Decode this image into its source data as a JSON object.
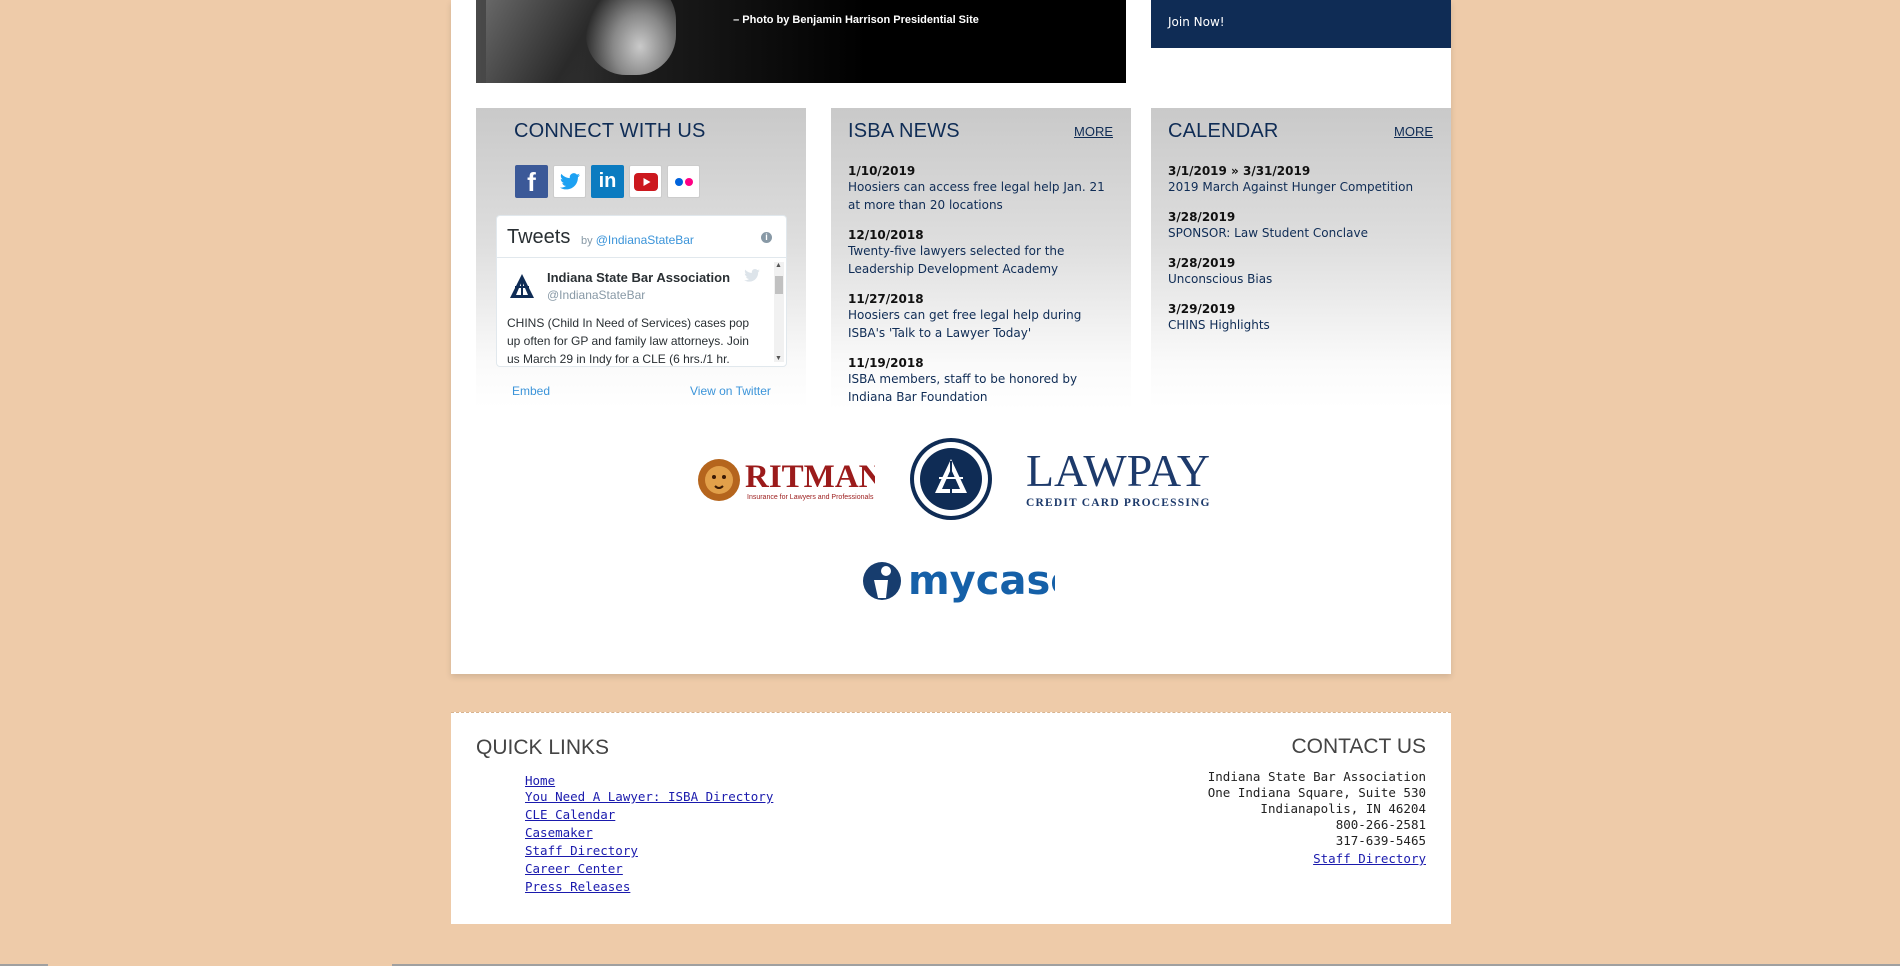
{
  "hero": {
    "photo_credit": "– Photo by Benjamin Harrison Presidential Site"
  },
  "join": {
    "label": "Join Now!"
  },
  "connect": {
    "title": "CONNECT WITH US",
    "social_icons": [
      "facebook-icon",
      "twitter-icon",
      "linkedin-icon",
      "youtube-icon",
      "flickr-icon"
    ],
    "timeline": {
      "heading": "Tweets",
      "by": "by",
      "handle_link": "@IndianaStateBar",
      "tweet": {
        "author": "Indiana State Bar Association",
        "handle": "@IndianaStateBar",
        "text": "CHINS (Child In Need of Services) cases pop up often for GP and family law attorneys. Join us March 29 in Indy for a CLE (6 hrs./1 hr."
      },
      "embed_label": "Embed",
      "view_label": "View on Twitter"
    }
  },
  "news": {
    "title": "ISBA NEWS",
    "more": "MORE",
    "items": [
      {
        "date": "1/10/2019",
        "title": "Hoosiers can access free legal help Jan. 21 at more than 20 locations"
      },
      {
        "date": "12/10/2018",
        "title": "Twenty-five lawyers selected for the Leadership Development Academy"
      },
      {
        "date": "11/27/2018",
        "title": "Hoosiers can get free legal help during ISBA's 'Talk to a Lawyer Today'"
      },
      {
        "date": "11/19/2018",
        "title": "ISBA members, staff to be honored by Indiana Bar Foundation"
      }
    ]
  },
  "calendar": {
    "title": "CALENDAR",
    "more": "MORE",
    "items": [
      {
        "date": "3/1/2019 » 3/31/2019",
        "title": "2019 March Against Hunger Competition"
      },
      {
        "date": "3/28/2019",
        "title": "SPONSOR: Law Student Conclave"
      },
      {
        "date": "3/28/2019",
        "title": "Unconscious Bias"
      },
      {
        "date": "3/29/2019",
        "title": "CHINS Highlights"
      }
    ]
  },
  "sponsors": {
    "ritman": {
      "name": "RITMAN",
      "tagline": "Insurance for Lawyers and Professionals"
    },
    "lawpay": {
      "name": "LAWPAY",
      "tagline": "CREDIT CARD PROCESSING"
    },
    "mycase": {
      "name": "mycase"
    }
  },
  "footer": {
    "quick_links_title": "QUICK LINKS",
    "quick_links": [
      "Home",
      "You Need A Lawyer: ISBA Directory",
      "CLE Calendar",
      "Casemaker",
      "Staff Directory",
      "Career Center",
      "Press Releases"
    ],
    "contact_title": "CONTACT US",
    "contact": {
      "org": "Indiana State Bar Association",
      "street": "One Indiana Square, Suite 530",
      "city": "Indianapolis, IN 46204",
      "phone1": "800-266-2581",
      "phone2": "317-639-5465",
      "staff_link": "Staff Directory"
    }
  },
  "colors": {
    "navy": "#0f2c55",
    "page_bg": "#eecba9",
    "link": "#1a1aad"
  }
}
